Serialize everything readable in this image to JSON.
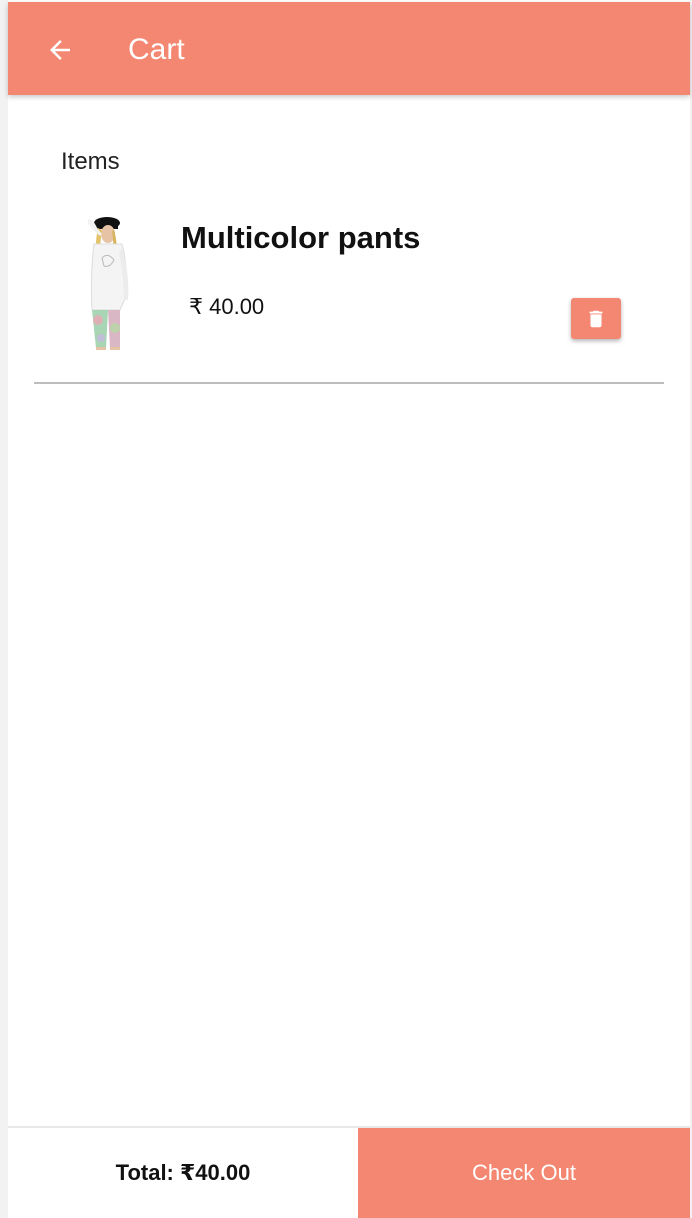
{
  "header": {
    "title": "Cart",
    "back_icon": "arrow-left-icon",
    "background_color": "#f48771"
  },
  "cart": {
    "section_label": "Items",
    "items": [
      {
        "name": "Multicolor pants",
        "price": "₹ 40.00",
        "thumbnail": "product-photo-model-in-white-top-and-multicolor-pants",
        "delete_icon": "trash-icon"
      }
    ]
  },
  "footer": {
    "total_label": "Total: ₹40.00",
    "checkout_label": "Check Out",
    "accent_color": "#f48771"
  }
}
